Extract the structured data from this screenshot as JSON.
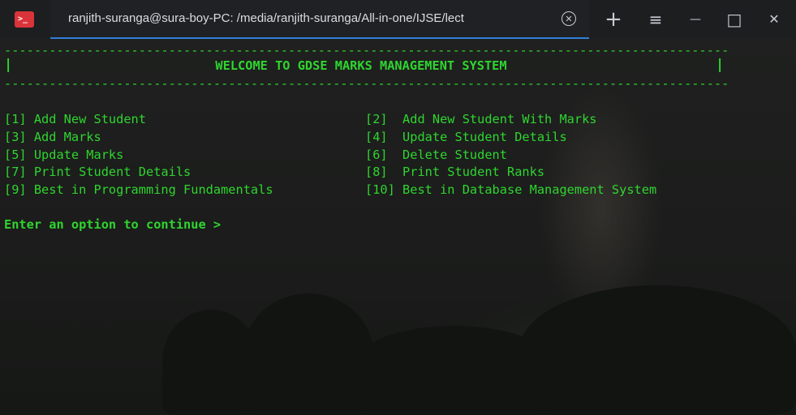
{
  "titlebar": {
    "tab_title": "ranjith-suranga@sura-boy-PC: /media/ranjith-suranga/All-in-one/IJSE/lect",
    "app_icon_glyph": ">_",
    "close_tab_glyph": "✕",
    "new_tab_glyph": "+",
    "menu_glyph": "≡",
    "minimize_glyph": "—",
    "maximize_glyph": "□",
    "close_glyph": "✕",
    "accent_color": "#2f7fd8"
  },
  "terminal": {
    "text_color": "#2fd52f",
    "rule_line": "-------------------------------------------------------------------------------------------------",
    "bar": "|",
    "welcome": "WELCOME TO GDSE MARKS MANAGEMENT SYSTEM",
    "menu_left": [
      "[1] Add New Student",
      "[3] Add Marks",
      "[5] Update Marks",
      "[7] Print Student Details",
      "[9] Best in Programming Fundamentals"
    ],
    "menu_right": [
      "[2]  Add New Student With Marks",
      "[4]  Update Student Details",
      "[6]  Delete Student",
      "[8]  Print Student Ranks",
      "[10] Best in Database Management System"
    ],
    "prompt": "Enter an option to continue >"
  }
}
